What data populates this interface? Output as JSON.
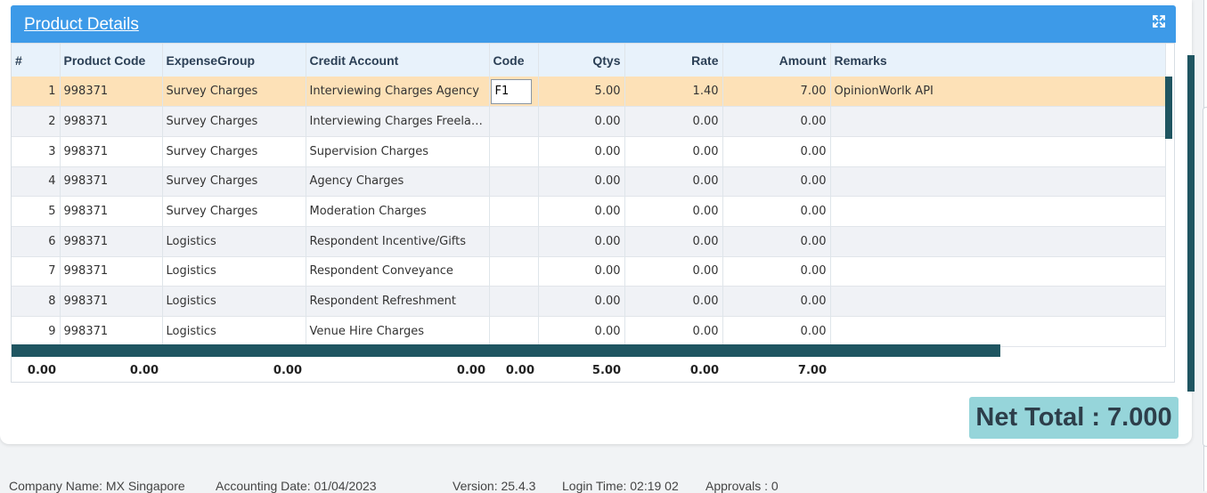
{
  "panel": {
    "title": "Product Details",
    "expand_icon": "expand-arrows-icon"
  },
  "table": {
    "columns": [
      "#",
      "Product Code",
      "ExpenseGroup",
      "Credit Account",
      "Code",
      "Qtys",
      "Rate",
      "Amount",
      "Remarks"
    ],
    "rows": [
      {
        "no": "1",
        "product_code": "998371",
        "expense_group": "Survey Charges",
        "credit_account": "Interviewing Charges Agency",
        "code": "F1",
        "qtys": "5.00",
        "rate": "1.40",
        "amount": "7.00",
        "remarks": "OpinionWorlk API"
      },
      {
        "no": "2",
        "product_code": "998371",
        "expense_group": "Survey Charges",
        "credit_account": "Interviewing Charges Freela…",
        "code": "",
        "qtys": "0.00",
        "rate": "0.00",
        "amount": "0.00",
        "remarks": ""
      },
      {
        "no": "3",
        "product_code": "998371",
        "expense_group": "Survey Charges",
        "credit_account": "Supervision Charges",
        "code": "",
        "qtys": "0.00",
        "rate": "0.00",
        "amount": "0.00",
        "remarks": ""
      },
      {
        "no": "4",
        "product_code": "998371",
        "expense_group": "Survey Charges",
        "credit_account": "Agency Charges",
        "code": "",
        "qtys": "0.00",
        "rate": "0.00",
        "amount": "0.00",
        "remarks": ""
      },
      {
        "no": "5",
        "product_code": "998371",
        "expense_group": "Survey Charges",
        "credit_account": "Moderation Charges",
        "code": "",
        "qtys": "0.00",
        "rate": "0.00",
        "amount": "0.00",
        "remarks": ""
      },
      {
        "no": "6",
        "product_code": "998371",
        "expense_group": "Logistics",
        "credit_account": "Respondent Incentive/Gifts",
        "code": "",
        "qtys": "0.00",
        "rate": "0.00",
        "amount": "0.00",
        "remarks": ""
      },
      {
        "no": "7",
        "product_code": "998371",
        "expense_group": "Logistics",
        "credit_account": "Respondent Conveyance",
        "code": "",
        "qtys": "0.00",
        "rate": "0.00",
        "amount": "0.00",
        "remarks": ""
      },
      {
        "no": "8",
        "product_code": "998371",
        "expense_group": "Logistics",
        "credit_account": "Respondent Refreshment",
        "code": "",
        "qtys": "0.00",
        "rate": "0.00",
        "amount": "0.00",
        "remarks": ""
      },
      {
        "no": "9",
        "product_code": "998371",
        "expense_group": "Logistics",
        "credit_account": "Venue Hire Charges",
        "code": "",
        "qtys": "0.00",
        "rate": "0.00",
        "amount": "0.00",
        "remarks": ""
      }
    ],
    "totals": [
      "0.00",
      "0.00",
      "0.00",
      "0.00",
      "0.00",
      "5.00",
      "0.00",
      "7.00"
    ]
  },
  "net_total": "Net Total : 7.000",
  "footer": {
    "company": "Company Name: MX Singapore",
    "accounting_date": "Accounting Date: 01/04/2023",
    "version": "Version: 25.4.3",
    "login_time": "Login Time: 02:19 02",
    "approvals": "Approvals : 0"
  },
  "colors": {
    "header": "#3d9ae8",
    "selected_row": "#fde1b7",
    "scrollbar": "#1f5561",
    "net_total_bg": "#96d5da"
  }
}
